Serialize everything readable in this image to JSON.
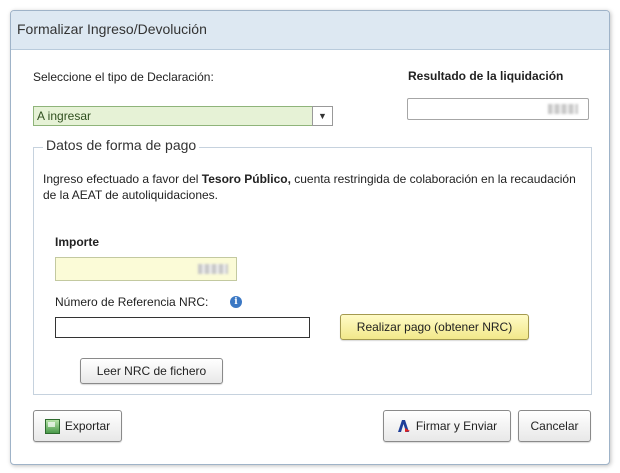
{
  "dialog": {
    "title": "Formalizar Ingreso/Devolución"
  },
  "declaration": {
    "label": "Seleccione el tipo de Declaración:",
    "selected": "A ingresar"
  },
  "result": {
    "label": "Resultado de la liquidación"
  },
  "payment": {
    "legend": "Datos de forma de pago",
    "desc_part1": "Ingreso efectuado a favor del ",
    "desc_bold": "Tesoro Público,",
    "desc_part2": " cuenta restringida de colaboración en la recaudación de la AEAT de autoliquidaciones.",
    "importe_label": "Importe",
    "nrc_label": "Número de Referencia  NRC:",
    "nrc_value": "",
    "realizar_button": "Realizar pago (obtener NRC)",
    "leer_button": "Leer NRC de fichero"
  },
  "footer": {
    "exportar_button": "Exportar",
    "firmar_button": "Firmar y Enviar",
    "cancelar_button": "Cancelar"
  },
  "colors": {
    "select_bg": "#e6f2d6",
    "importe_bg": "#fbfbd7",
    "titlebar_bg": "#dde8f2"
  }
}
